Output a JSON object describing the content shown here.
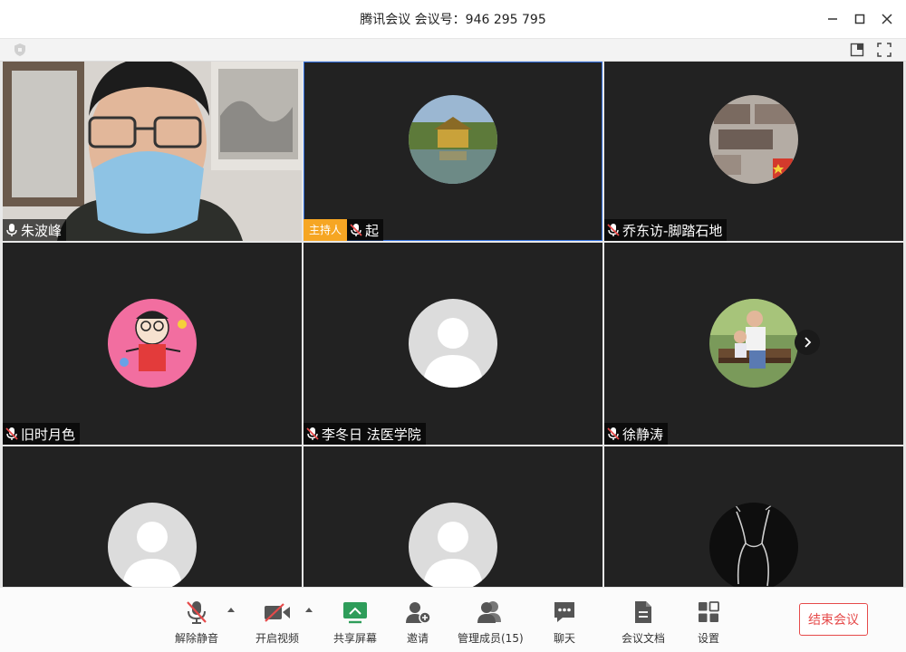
{
  "window": {
    "title": "腾讯会议  会议号：946 295 795"
  },
  "participants": [
    {
      "name": "朱波峰",
      "muted": false,
      "host": false
    },
    {
      "name": "起",
      "muted": true,
      "host": true,
      "host_label": "主持人"
    },
    {
      "name": "乔东访-脚踏石地",
      "muted": true,
      "host": false
    },
    {
      "name": "旧时月色",
      "muted": true,
      "host": false
    },
    {
      "name": "李冬日 法医学院",
      "muted": true,
      "host": false
    },
    {
      "name": "徐静涛",
      "muted": true,
      "host": false
    },
    {
      "name": "",
      "muted": true,
      "host": false
    },
    {
      "name": "",
      "muted": true,
      "host": false
    },
    {
      "name": "",
      "muted": true,
      "host": false
    }
  ],
  "toolbar": {
    "unmute": "解除静音",
    "start_video": "开启视频",
    "share_screen": "共享屏幕",
    "invite": "邀请",
    "manage_members": "管理成员(15)",
    "chat": "聊天",
    "docs": "会议文档",
    "settings": "设置",
    "end_meeting": "结束会议"
  },
  "colors": {
    "accent_host": "#f6a623",
    "end_red": "#e64a4a",
    "active_border": "#2f6ee0",
    "tile_bg": "#222222"
  }
}
